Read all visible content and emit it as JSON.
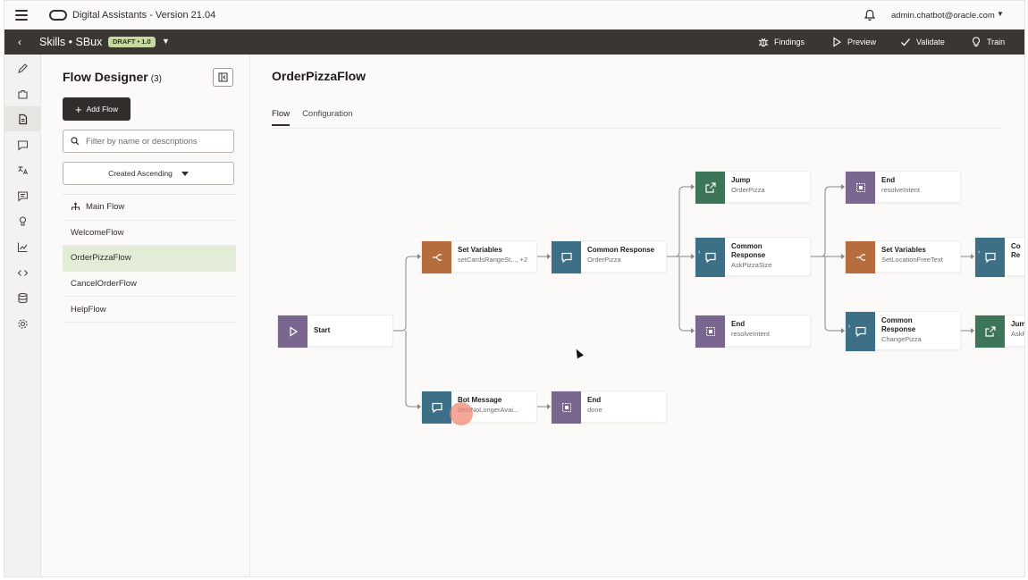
{
  "app": {
    "title": "Digital Assistants - Version 21.04",
    "user": "admin.chatbot@oracle.com"
  },
  "header": {
    "skill": "Skills • SBux",
    "badge": "DRAFT • 1.0",
    "actions": {
      "findings": "Findings",
      "preview": "Preview",
      "validate": "Validate",
      "train": "Train"
    }
  },
  "panel": {
    "title": "Flow Designer",
    "count": "(3)",
    "add_label": "Add Flow",
    "search_placeholder": "Filter by name or descriptions",
    "sort_label": "Created Ascending",
    "flows": [
      "Main Flow",
      "WelcomeFlow",
      "OrderPizzaFlow",
      "CancelOrderFlow",
      "HelpFlow"
    ],
    "selected": "OrderPizzaFlow"
  },
  "main": {
    "title": "OrderPizzaFlow",
    "tabs": [
      "Flow",
      "Configuration"
    ],
    "active_tab": "Flow"
  },
  "nodes": {
    "start": {
      "title": "Start",
      "sub": ""
    },
    "setvars1": {
      "title": "Set Variables",
      "sub": "setCardsRangeSt..., +2"
    },
    "common1": {
      "title": "Common Response",
      "sub": "OrderPizza"
    },
    "botmsg": {
      "title": "Bot Message",
      "sub": "ItemNoLongerAvai..."
    },
    "end_done": {
      "title": "End",
      "sub": "done"
    },
    "jump1": {
      "title": "Jump",
      "sub": "OrderPizza"
    },
    "common2": {
      "title": "Common Response",
      "sub": "AskPizzaSize"
    },
    "end1": {
      "title": "End",
      "sub": "resolveIntent"
    },
    "end2": {
      "title": "End",
      "sub": "resolveIntent"
    },
    "setvars2": {
      "title": "Set Variables",
      "sub": "SetLocationFreeText"
    },
    "common3": {
      "title": "Common Response",
      "sub": "ChangePizza"
    },
    "common4": {
      "title": "Co",
      "sub": "Re"
    },
    "jump2": {
      "title": "Jump",
      "sub": "AskP"
    }
  },
  "colors": {
    "purple": "#7b6690",
    "orange": "#b56d3e",
    "teal": "#3d6f86",
    "green": "#3d7558",
    "selected": "#e3ecd7",
    "header": "#3a3632"
  }
}
